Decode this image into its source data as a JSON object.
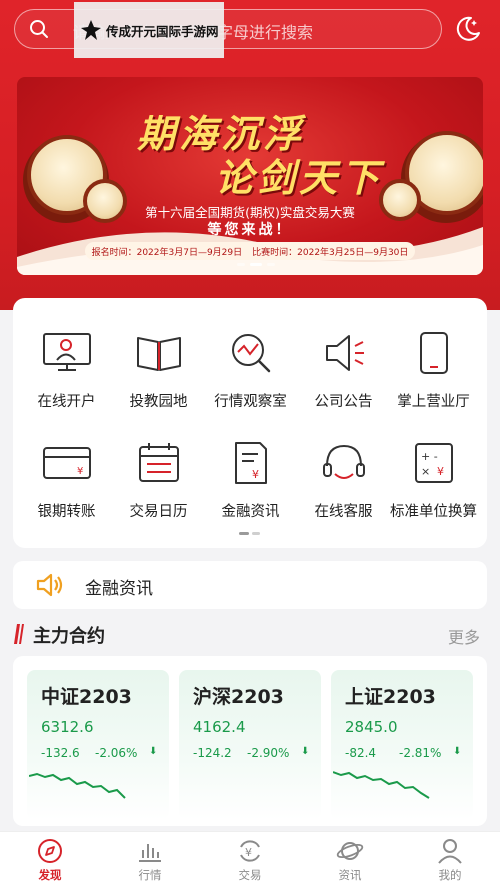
{
  "search": {
    "placeholder": "请输入合约代码或首字母进行搜索"
  },
  "watermark": {
    "text": "传成开元国际手游网"
  },
  "banner": {
    "title_line1": "期海沉浮",
    "title_line2": "论剑天下",
    "subtitle": "第十六届全国期货(期权)实盘交易大赛",
    "call": "等您来战！",
    "signup": "报名时间：2022年3月7日—9月29日",
    "contest": "比赛时间：2022年3月25日—9月30日"
  },
  "menu": {
    "items": [
      {
        "label": "在线开户",
        "icon": "monitor-user-icon"
      },
      {
        "label": "投教园地",
        "icon": "open-book-icon"
      },
      {
        "label": "行情观察室",
        "icon": "magnifier-chart-icon"
      },
      {
        "label": "公司公告",
        "icon": "megaphone-icon"
      },
      {
        "label": "掌上营业厅",
        "icon": "phone-icon"
      },
      {
        "label": "银期转账",
        "icon": "bank-card-icon"
      },
      {
        "label": "交易日历",
        "icon": "calendar-icon"
      },
      {
        "label": "金融资讯",
        "icon": "document-yen-icon"
      },
      {
        "label": "在线客服",
        "icon": "headset-icon"
      },
      {
        "label": "标准单位换算",
        "icon": "calculator-icon"
      }
    ]
  },
  "news": {
    "label": "金融资讯"
  },
  "section": {
    "title": "主力合约",
    "more": "更多"
  },
  "contracts": [
    {
      "name": "中证2203",
      "price": "6312.6",
      "change": "-132.6",
      "percent": "-2.06%",
      "arrow": "⬇"
    },
    {
      "name": "沪深2203",
      "price": "4162.4",
      "change": "-124.2",
      "percent": "-2.90%",
      "arrow": "⬇"
    },
    {
      "name": "上证2203",
      "price": "2845.0",
      "change": "-82.4",
      "percent": "-2.81%",
      "arrow": "⬇"
    }
  ],
  "tabs": [
    {
      "label": "发现",
      "icon": "discover-icon",
      "active": true
    },
    {
      "label": "行情",
      "icon": "chart-bars-icon",
      "active": false
    },
    {
      "label": "交易",
      "icon": "yen-exchange-icon",
      "active": false
    },
    {
      "label": "资讯",
      "icon": "planet-icon",
      "active": false
    },
    {
      "label": "我的",
      "icon": "user-icon",
      "active": false
    }
  ],
  "colors": {
    "brand_red": "#d6232a",
    "down_green": "#1a9a4a",
    "banner_gold": "#ffe066"
  }
}
